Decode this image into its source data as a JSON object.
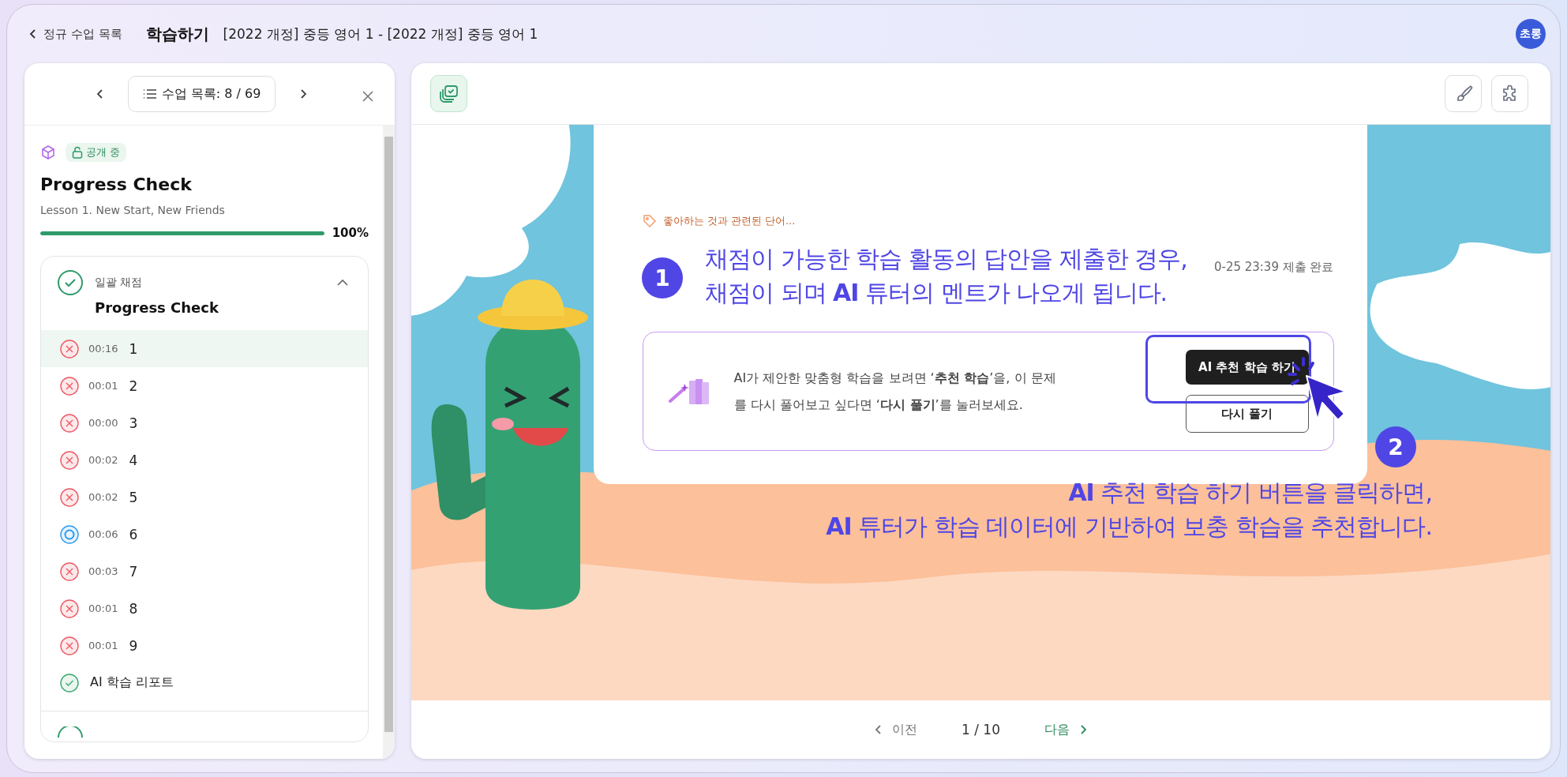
{
  "topbar": {
    "back_link": "정규 수업 목록",
    "title": "학습하기",
    "course": "[2022 개정] 중등 영어 1 - [2022 개정] 중등 영어 1",
    "avatar": "초롱"
  },
  "sidebar": {
    "lesson_list_button": "수업 목록: 8 / 69",
    "badge": "공개 중",
    "title": "Progress Check",
    "subtitle": "Lesson 1. New Start, New Friends",
    "progress": {
      "level": 1,
      "reading": "100%"
    },
    "section": {
      "label": "일괄 채점",
      "title": "Progress Check",
      "expanded": true,
      "done": true,
      "items": [
        {
          "kind": "wrong",
          "time": "00:16",
          "label": "1",
          "selected": true
        },
        {
          "kind": "wrong",
          "time": "00:01",
          "label": "2",
          "selected": false
        },
        {
          "kind": "wrong",
          "time": "00:00",
          "label": "3",
          "selected": false
        },
        {
          "kind": "wrong",
          "time": "00:02",
          "label": "4",
          "selected": false
        },
        {
          "kind": "wrong",
          "time": "00:02",
          "label": "5",
          "selected": false
        },
        {
          "kind": "correct",
          "time": "00:06",
          "label": "6",
          "selected": false
        },
        {
          "kind": "wrong",
          "time": "00:03",
          "label": "7",
          "selected": false
        },
        {
          "kind": "wrong",
          "time": "00:01",
          "label": "8",
          "selected": false
        },
        {
          "kind": "wrong",
          "time": "00:01",
          "label": "9",
          "selected": false
        },
        {
          "kind": "report",
          "label": "AI 학습 리포트",
          "selected": false
        }
      ]
    }
  },
  "activity": {
    "tag": "좋아하는 것과 관련된 단어...",
    "submitted": "0-25 23:39 제출 완료",
    "recommendation": {
      "text": "AI가 제안한 맞춤형 학습을 보려면 ‘**추천 학습**’을, 이 문제를 다시 풀어보고 싶다면 ‘**다시 풀기**’를 눌러보세요.",
      "buttons": [
        {
          "label": "AI 추천 학습 하기",
          "kind": "primary"
        },
        {
          "label": "다시 풀기",
          "kind": "secondary"
        }
      ]
    }
  },
  "annotations": [
    {
      "number": "1",
      "lines": [
        "채점이 가능한 학습 활동의 답안을 제출한 경우,",
        "채점이 되며 **AI** 튜터의 멘트가 나오게 됩니다."
      ]
    },
    {
      "number": "2",
      "lines": [
        "**AI** 추천 학습 하기 버튼을 클릭하면,",
        "**AI** 튜터가 학습 데이터에 기반하여 보충 학습을 추천합니다."
      ]
    }
  ],
  "pager": {
    "prev": {
      "label": "이전",
      "disabled": true
    },
    "page": "1 / 10",
    "next": {
      "label": "다음",
      "disabled": false
    }
  }
}
